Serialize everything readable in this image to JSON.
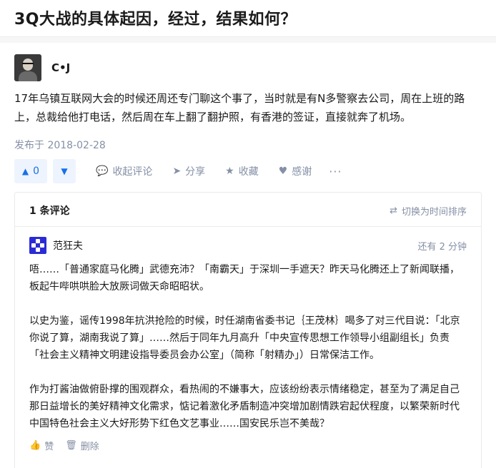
{
  "question": {
    "title": "3Q大战的具体起因，经过，结果如何？"
  },
  "answer": {
    "author_name": "C•J",
    "content": "17年乌镇互联网大会的时候还周还专门聊这个事了，当时就是有N多警察去公司，周在上班的路上，总裁给他打电话，然后周在车上翻了翻护照，有香港的签证，直接就奔了机场。",
    "date": "发布于 2018-02-28",
    "votes": "0",
    "actions": {
      "comments": "收起评论",
      "share": "分享",
      "favorite": "收藏",
      "thanks": "感谢",
      "more": "···"
    },
    "icons": {
      "vote_up": "triangle-up-icon",
      "vote_down": "triangle-down-icon",
      "comment": "comment-icon",
      "share": "share-icon",
      "favorite": "star-icon",
      "thanks": "heart-icon"
    }
  },
  "comments": {
    "count_label": "1 条评论",
    "sort_label": "切换为时间排序",
    "items": [
      {
        "name": "范狂夫",
        "time": "还有 2 分钟",
        "paragraphs": [
          "唔……「普通家庭马化腾」武德充沛？「南霸天」于深圳一手遮天？昨天马化腾还上了新闻联播，板起牛哔哄哄脸大放厥词做天命昭昭状。",
          "以史为鉴，谣传1998年抗洪抢险的时候，时任湖南省委书记｛王茂林｝喝多了对三代目说：「北京你说了算，湖南我说了算」……然后于同年九月高升「中央宣传思想工作领导小组副组长」负责「社会主义精神文明建设指导委员会办公室」（简称「射精办」）日常保洁工作。",
          "作为打酱油做俯卧撑的围观群众，看热闹的不嫌事大，应该纷纷表示情绪稳定，甚至为了满足自己那日益增长的美好精神文化需求，惦记着激化矛盾制造冲突增加剧情跌宕起伏程度，以繁荣新时代中国特色社会主义大好形势下红色文艺事业……国安民乐岂不美哉？"
        ],
        "like_label": "赞",
        "delete_label": "删除"
      }
    ]
  },
  "colors": {
    "accent": "#1771e6",
    "muted": "#8590a6",
    "vote_bg": "#eef4fd"
  }
}
